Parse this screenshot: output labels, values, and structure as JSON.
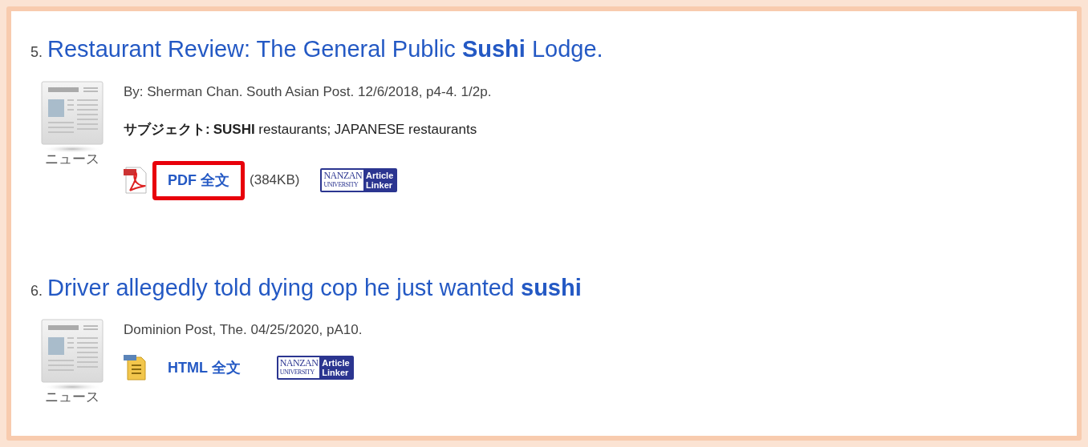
{
  "results": [
    {
      "number": "5.",
      "title": "Restaurant Review: The General Public **Sushi** Lodge.",
      "type_label": "ニュース",
      "source": "By: Sherman Chan. South Asian Post. 12/6/2018, p4-4. 1/2p.",
      "subject": {
        "label": "サブジェクト:",
        "value": "**SUSHI** restaurants; JAPANESE restaurants"
      },
      "links": [
        {
          "kind": "pdf",
          "label": "PDF 全文",
          "size": "(384KB)",
          "highlighted": true
        },
        {
          "kind": "linker",
          "lines": [
            "NANZAN",
            "UNIVERSITY"
          ],
          "badge": [
            "Article",
            "Linker"
          ]
        }
      ]
    },
    {
      "number": "6.",
      "title": "Driver allegedly told dying cop he just wanted **sushi**",
      "type_label": "ニュース",
      "source": "Dominion Post, The. 04/25/2020, pA10.",
      "links": [
        {
          "kind": "html",
          "label": "HTML 全文",
          "highlighted": false
        },
        {
          "kind": "linker",
          "lines": [
            "NANZAN",
            "UNIVERSITY"
          ],
          "badge": [
            "Article",
            "Linker"
          ]
        }
      ]
    }
  ]
}
